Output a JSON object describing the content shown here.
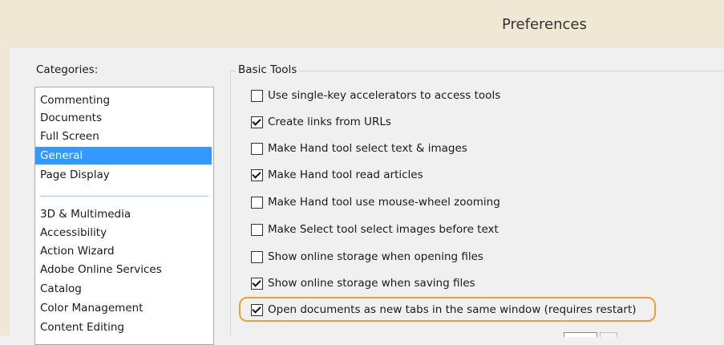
{
  "window": {
    "title": "Preferences"
  },
  "categories": {
    "label": "Categories:",
    "top_items": [
      "Commenting",
      "Documents",
      "Full Screen",
      "General",
      "Page Display"
    ],
    "selected": "General",
    "other_items": [
      "3D & Multimedia",
      "Accessibility",
      "Action Wizard",
      "Adobe Online Services",
      "Catalog",
      "Color Management",
      "Content Editing"
    ]
  },
  "basic_tools": {
    "title": "Basic Tools",
    "options": [
      {
        "label": "Use single-key accelerators to access tools",
        "checked": false
      },
      {
        "label": "Create links from URLs",
        "checked": true
      },
      {
        "label": "Make Hand tool select text & images",
        "checked": false
      },
      {
        "label": "Make Hand tool read articles",
        "checked": true
      },
      {
        "label": "Make Hand tool use mouse-wheel zooming",
        "checked": false
      },
      {
        "label": "Make Select tool select images before text",
        "checked": false
      },
      {
        "label": "Show online storage when opening files",
        "checked": false
      },
      {
        "label": "Show online storage when saving files",
        "checked": true
      },
      {
        "label": "Open documents as new tabs in the same window (requires restart)",
        "checked": true
      }
    ]
  },
  "colors": {
    "selection": "#3399ff",
    "highlight": "#f0a030",
    "titlebar": "#f0e7d4"
  }
}
